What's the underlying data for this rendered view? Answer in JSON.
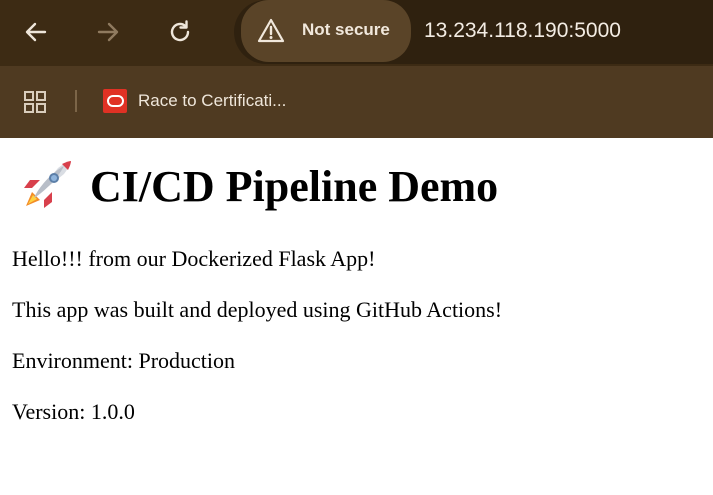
{
  "browser": {
    "security_label": "Not secure",
    "url": "13.234.118.190:5000",
    "bookmarks": [
      {
        "label": "Race to Certificati...",
        "icon": "oracle-favicon"
      }
    ],
    "colors": {
      "toolbar": "#3d2b14",
      "bookmarks_bar": "#4f3a21",
      "omnibox": "#2f210f",
      "security_chip": "#5a4428"
    }
  },
  "page": {
    "heading_emoji": "rocket-icon",
    "heading": "CI/CD Pipeline Demo",
    "paragraphs": [
      "Hello!!! from our Dockerized Flask App!",
      "This app was built and deployed using GitHub Actions!",
      "Environment: Production",
      "Version: 1.0.0"
    ]
  }
}
